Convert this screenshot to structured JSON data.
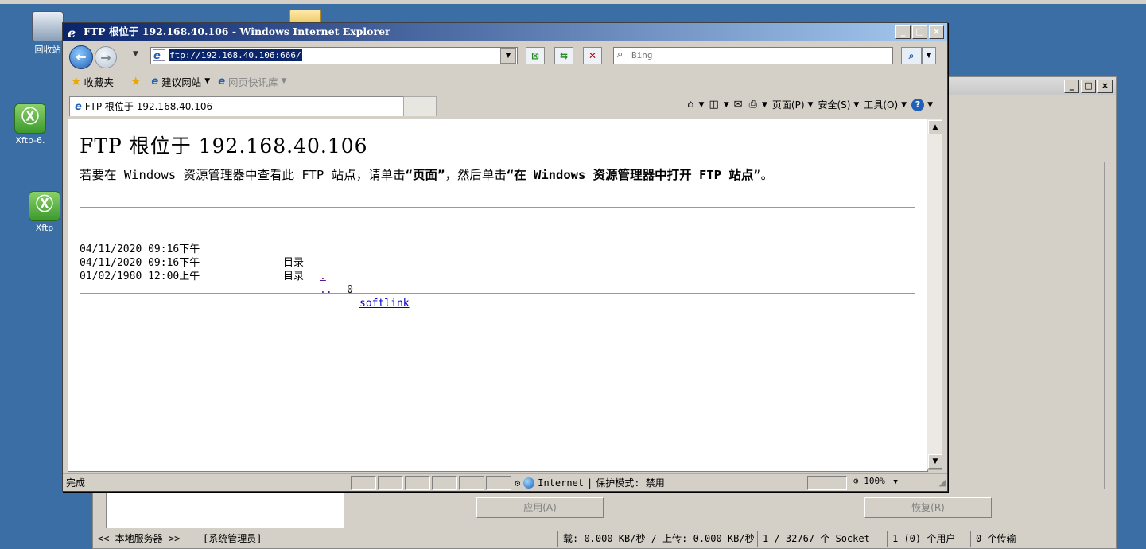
{
  "desktop": {
    "icons": [
      {
        "label": "回收站"
      },
      {
        "label": "Xftp-6."
      },
      {
        "label": "Xftp"
      }
    ]
  },
  "bg_window": {
    "apply_button": "应用(A)",
    "restore_button": "恢复(R)",
    "status": {
      "local_server": "<< 本地服务器 >>",
      "admin": "[系统管理员]",
      "rates": "载: 0.000 KB/秒 / 上传: 0.000 KB/秒",
      "sockets": "1 / 32767 个 Socket",
      "users": "1 (0) 个用户",
      "transfers": "0 个传输"
    }
  },
  "ie": {
    "title": "FTP 根位于 192.168.40.106 - Windows Internet Explorer",
    "address": "ftp://192.168.40.106:666/",
    "search_placeholder": "Bing",
    "favorites": {
      "favorites_label": "收藏夹",
      "suggested_sites": "建议网站",
      "web_slice_gallery": "网页快讯库"
    },
    "tab_title": "FTP 根位于 192.168.40.106",
    "commands": {
      "page": "页面(P)",
      "safety": "安全(S)",
      "tools": "工具(O)"
    },
    "status": {
      "text": "完成",
      "zone": "Internet",
      "protected_mode": "保护模式: 禁用",
      "zoom": "100%"
    }
  },
  "page": {
    "heading": "FTP 根位于 192.168.40.106",
    "desc_prefix": "若要在 Windows 资源管理器中查看此 FTP 站点，请单击",
    "desc_page": "“页面”",
    "desc_mid": "，然后单击",
    "desc_open": "“在 Windows 资源管理器中打开 FTP 站点”",
    "desc_end": "。",
    "listing": [
      {
        "date": "04/11/2020 09:16下午",
        "type": "目录",
        "size": "",
        "name": "."
      },
      {
        "date": "04/11/2020 09:16下午",
        "type": "目录",
        "size": "",
        "name": ".."
      },
      {
        "date": "01/02/1980 12:00上午",
        "type": "",
        "size": "0",
        "name": "softlink"
      }
    ]
  }
}
